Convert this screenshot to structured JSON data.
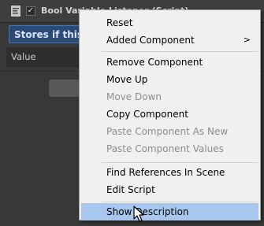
{
  "component": {
    "title": "Bool Variable Listener (Script)",
    "enabled_check": "✓",
    "description": "Stores if this",
    "value_label": "Value"
  },
  "context_menu": {
    "items": [
      {
        "label": "Reset",
        "enabled": true
      },
      {
        "label": "Added Component",
        "enabled": true,
        "submenu_arrow": ">"
      },
      {
        "label": "Remove Component",
        "enabled": true
      },
      {
        "label": "Move Up",
        "enabled": true
      },
      {
        "label": "Move Down",
        "enabled": false
      },
      {
        "label": "Copy Component",
        "enabled": true
      },
      {
        "label": "Paste Component As New",
        "enabled": false
      },
      {
        "label": "Paste Component Values",
        "enabled": false
      },
      {
        "label": "Find References In Scene",
        "enabled": true
      },
      {
        "label": "Edit Script",
        "enabled": true
      },
      {
        "label": "Show Description",
        "enabled": true,
        "highlighted": true
      }
    ]
  },
  "colors": {
    "menu_background": "#f0f0f0",
    "menu_highlight": "#a7c7ef",
    "disabled_text": "#8c8c8c",
    "inspector_background": "#383838",
    "description_box": "#2b4a75"
  },
  "icons": {
    "component": "script-component-icon",
    "cursor": "mouse-pointer-icon"
  }
}
